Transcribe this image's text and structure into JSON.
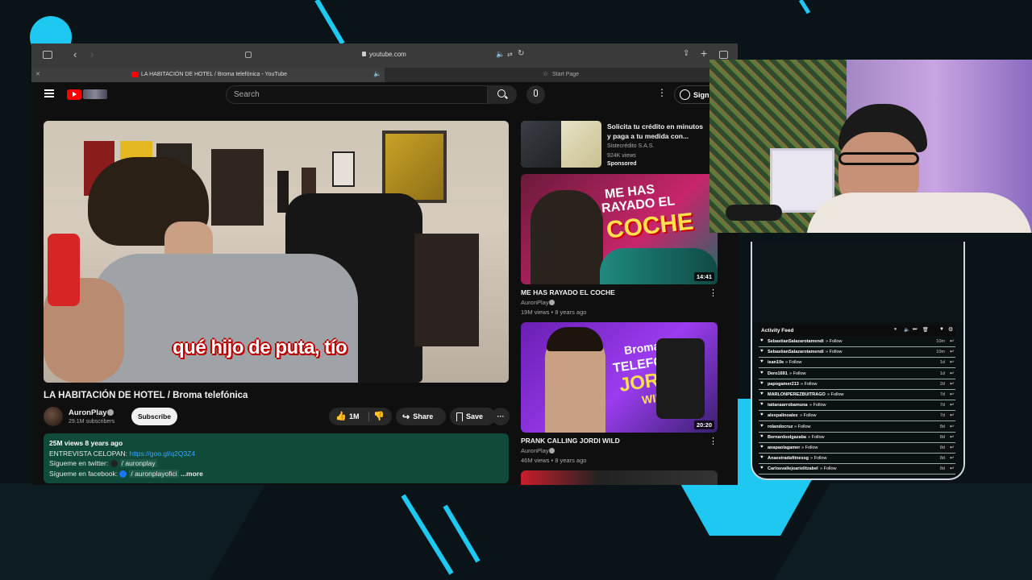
{
  "browser": {
    "url": "youtube.com",
    "tab_active_title": "LA HABITACIÓN DE HOTEL / Broma telefónica - YouTube",
    "tab_inactive_title": "Start Page"
  },
  "youtube": {
    "search_placeholder": "Search",
    "sign_in": "Sign",
    "caption": "qué hijo de puta, tío",
    "video_title": "LA HABITACIÓN DE HOTEL / Broma telefónica",
    "channel": "AuronPlay",
    "subscribers": "29.1M subscribers",
    "subscribe": "Subscribe",
    "likes": "1M",
    "share": "Share",
    "save": "Save",
    "views_date": "25M views  8 years ago",
    "desc_line1_label": "ENTREVISTA CELOPAN: ",
    "desc_line1_link": "https://goo.gl/q2Q3Z4",
    "desc_line2_label": "Sígueme en twitter: ",
    "desc_line2_link": "/ auronplay",
    "desc_line3_label": "Sígueme en facebook: ",
    "desc_line3_link": "/ auronplayofici",
    "desc_more": "...more"
  },
  "sidebar": {
    "ad_title": "Solicita tu crédito en minutos y paga a tu medida con...",
    "ad_channel": "Sistecrédito S.A.S.",
    "ad_views": "924K views",
    "ad_label": "Sponsored",
    "videos": [
      {
        "thumb_text_1": "ME HAS",
        "thumb_text_2": "RAYADO EL",
        "thumb_text_3": "COCHE",
        "duration": "14:41",
        "title": "ME HAS RAYADO EL COCHE",
        "channel": "AuronPlay",
        "meta": "19M views • 8 years ago"
      },
      {
        "thumb_text_1": "Broma",
        "thumb_text_2": "TELEFÓNICA",
        "thumb_text_3": "JORDI",
        "thumb_text_4": "WILD",
        "duration": "20:20",
        "title": "PRANK CALLING JORDI WILD",
        "channel": "AuronPlay",
        "meta": "46M views • 8 years ago"
      }
    ]
  },
  "activity": {
    "title": "Activity Feed",
    "rows": [
      {
        "user": "SebastianSalazarotamendi",
        "action": "» Follow",
        "ago": "10m"
      },
      {
        "user": "SebastianSalazarotamendi",
        "action": "» Follow",
        "ago": "10m"
      },
      {
        "user": "isan10e",
        "action": "» Follow",
        "ago": "1d"
      },
      {
        "user": "Dero1691",
        "action": "» Follow",
        "ago": "1d"
      },
      {
        "user": "papogamer213",
        "action": "» Follow",
        "ago": "2d"
      },
      {
        "user": "MARLONPEREZBUITRAGO",
        "action": "» Follow",
        "ago": "7d"
      },
      {
        "user": "tatianaarrobamuna",
        "action": "» Follow",
        "ago": "7d"
      },
      {
        "user": "alexpalinoalex",
        "action": "» Follow",
        "ago": "7d"
      },
      {
        "user": "rolandocruz",
        "action": "» Follow",
        "ago": "8d"
      },
      {
        "user": "Bernardoolgazaba",
        "action": "» Follow",
        "ago": "8d"
      },
      {
        "user": "anapaolagamer",
        "action": "» Follow",
        "ago": "8d"
      },
      {
        "user": "Anaestradafitnessg",
        "action": "» Follow",
        "ago": "8d"
      },
      {
        "user": "Carlosvallejoarielitzabel",
        "action": "» Follow",
        "ago": "8d"
      }
    ]
  },
  "colors": {
    "accent_cyan": "#1ec8f0",
    "yt_red": "#ff0000",
    "desc_green": "#0f4a3a"
  }
}
